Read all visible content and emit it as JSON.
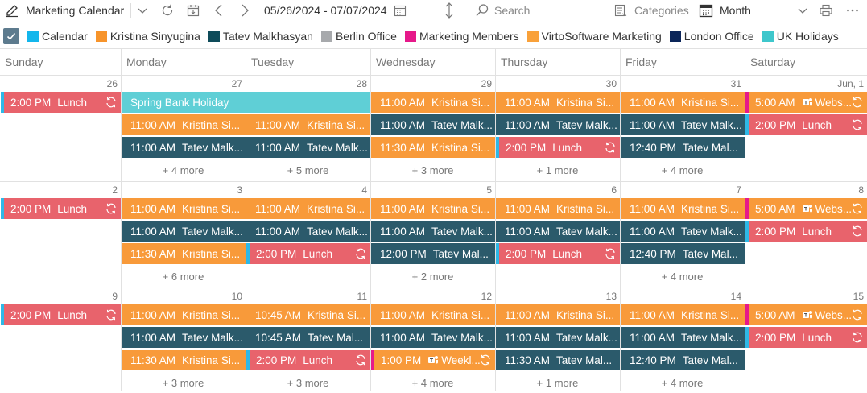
{
  "toolbar": {
    "calendar_name": "Marketing Calendar",
    "date_range": "05/26/2024 - 07/07/2024",
    "search_placeholder": "Search",
    "categories_label": "Categories",
    "view_label": "Month"
  },
  "legend": [
    {
      "label": "Calendar",
      "color": "#13b6ec"
    },
    {
      "label": "Kristina Sinyugina",
      "color": "#f7942b"
    },
    {
      "label": "Tatev Malkhasyan",
      "color": "#0e4b5a"
    },
    {
      "label": "Berlin Office",
      "color": "#a7a9ac"
    },
    {
      "label": "Marketing Members",
      "color": "#e6198a"
    },
    {
      "label": "VirtoSoftware Marketing",
      "color": "#f9a13a"
    },
    {
      "label": "London Office",
      "color": "#0b2559"
    },
    {
      "label": "UK Holidays",
      "color": "#3ec7cc"
    }
  ],
  "colors": {
    "orange": "#f89a3a",
    "teal": "#2b5a6b",
    "red": "#e8636c",
    "cyan": "#5fcfd6",
    "lunch_bar": "#2eb8e6",
    "webinar_bar": "#e6198a"
  },
  "days_of_week": [
    "Sunday",
    "Monday",
    "Tuesday",
    "Wednesday",
    "Thursday",
    "Friday",
    "Saturday"
  ],
  "weeks": [
    {
      "days": [
        "26",
        "27",
        "28",
        "29",
        "30",
        "31",
        "Jun, 1"
      ],
      "more": [
        "",
        "+ 4 more",
        "+ 5 more",
        "+ 3 more",
        "+ 1 more",
        "+ 4 more",
        ""
      ],
      "events": [
        {
          "day": 0,
          "row": 0,
          "time": "2:00 PM",
          "title": "Lunch",
          "kind": "lunch",
          "recurring": true
        },
        {
          "day": 1,
          "span": 2,
          "row": 0,
          "time": "",
          "title": "Spring Bank Holiday",
          "kind": "holiday"
        },
        {
          "day": 1,
          "row": 1,
          "time": "11:00 AM",
          "title": "Kristina Si...",
          "kind": "orange"
        },
        {
          "day": 1,
          "row": 2,
          "time": "11:00 AM",
          "title": "Tatev Malk...",
          "kind": "teal"
        },
        {
          "day": 2,
          "row": 1,
          "time": "11:00 AM",
          "title": "Kristina Si...",
          "kind": "orange"
        },
        {
          "day": 2,
          "row": 2,
          "time": "11:00 AM",
          "title": "Tatev Malk...",
          "kind": "teal"
        },
        {
          "day": 3,
          "row": 0,
          "time": "11:00 AM",
          "title": "Kristina Si...",
          "kind": "orange"
        },
        {
          "day": 3,
          "row": 1,
          "time": "11:00 AM",
          "title": "Tatev Malk...",
          "kind": "teal"
        },
        {
          "day": 3,
          "row": 2,
          "time": "11:30 AM",
          "title": "Kristina Si...",
          "kind": "orange"
        },
        {
          "day": 4,
          "row": 0,
          "time": "11:00 AM",
          "title": "Kristina Si...",
          "kind": "orange"
        },
        {
          "day": 4,
          "row": 1,
          "time": "11:00 AM",
          "title": "Tatev Malk...",
          "kind": "teal"
        },
        {
          "day": 4,
          "row": 2,
          "time": "2:00 PM",
          "title": "Lunch",
          "kind": "lunch",
          "recurring": true
        },
        {
          "day": 5,
          "row": 0,
          "time": "11:00 AM",
          "title": "Kristina Si...",
          "kind": "orange"
        },
        {
          "day": 5,
          "row": 1,
          "time": "11:00 AM",
          "title": "Tatev Malk...",
          "kind": "teal"
        },
        {
          "day": 5,
          "row": 2,
          "time": "12:40 PM",
          "title": "Tatev Mal...",
          "kind": "teal"
        },
        {
          "day": 6,
          "row": 0,
          "time": "5:00 AM",
          "title": "Webs...",
          "kind": "webinar",
          "recurring": true,
          "teams": true
        },
        {
          "day": 6,
          "row": 1,
          "time": "2:00 PM",
          "title": "Lunch",
          "kind": "lunch",
          "recurring": true
        }
      ]
    },
    {
      "days": [
        "2",
        "3",
        "4",
        "5",
        "6",
        "7",
        "8"
      ],
      "more": [
        "",
        "+ 6 more",
        "",
        "+ 2 more",
        "",
        "+ 4 more",
        ""
      ],
      "events": [
        {
          "day": 0,
          "row": 0,
          "time": "2:00 PM",
          "title": "Lunch",
          "kind": "lunch",
          "recurring": true
        },
        {
          "day": 1,
          "row": 0,
          "time": "11:00 AM",
          "title": "Kristina Si...",
          "kind": "orange"
        },
        {
          "day": 1,
          "row": 1,
          "time": "11:00 AM",
          "title": "Tatev Malk...",
          "kind": "teal"
        },
        {
          "day": 1,
          "row": 2,
          "time": "11:30 AM",
          "title": "Kristina Si...",
          "kind": "orange"
        },
        {
          "day": 2,
          "row": 0,
          "time": "11:00 AM",
          "title": "Kristina Si...",
          "kind": "orange"
        },
        {
          "day": 2,
          "row": 1,
          "time": "11:00 AM",
          "title": "Tatev Malk...",
          "kind": "teal"
        },
        {
          "day": 2,
          "row": 2,
          "time": "2:00 PM",
          "title": "Lunch",
          "kind": "lunch",
          "recurring": true
        },
        {
          "day": 3,
          "row": 0,
          "time": "11:00 AM",
          "title": "Kristina Si...",
          "kind": "orange"
        },
        {
          "day": 3,
          "row": 1,
          "time": "11:00 AM",
          "title": "Tatev Malk...",
          "kind": "teal"
        },
        {
          "day": 3,
          "row": 2,
          "time": "12:00 PM",
          "title": "Tatev Mal...",
          "kind": "teal"
        },
        {
          "day": 4,
          "row": 0,
          "time": "11:00 AM",
          "title": "Kristina Si...",
          "kind": "orange"
        },
        {
          "day": 4,
          "row": 1,
          "time": "11:00 AM",
          "title": "Tatev Malk...",
          "kind": "teal"
        },
        {
          "day": 4,
          "row": 2,
          "time": "2:00 PM",
          "title": "Lunch",
          "kind": "lunch",
          "recurring": true
        },
        {
          "day": 5,
          "row": 0,
          "time": "11:00 AM",
          "title": "Kristina Si...",
          "kind": "orange"
        },
        {
          "day": 5,
          "row": 1,
          "time": "11:00 AM",
          "title": "Tatev Malk...",
          "kind": "teal"
        },
        {
          "day": 5,
          "row": 2,
          "time": "12:40 PM",
          "title": "Tatev Mal...",
          "kind": "teal"
        },
        {
          "day": 6,
          "row": 0,
          "time": "5:00 AM",
          "title": "Webs...",
          "kind": "webinar",
          "recurring": true,
          "teams": true
        },
        {
          "day": 6,
          "row": 1,
          "time": "2:00 PM",
          "title": "Lunch",
          "kind": "lunch",
          "recurring": true
        }
      ]
    },
    {
      "days": [
        "9",
        "10",
        "11",
        "12",
        "13",
        "14",
        "15"
      ],
      "more": [
        "",
        "+ 3 more",
        "+ 3 more",
        "+ 4 more",
        "+ 1 more",
        "+ 4 more",
        ""
      ],
      "events": [
        {
          "day": 0,
          "row": 0,
          "time": "2:00 PM",
          "title": "Lunch",
          "kind": "lunch",
          "recurring": true
        },
        {
          "day": 1,
          "row": 0,
          "time": "11:00 AM",
          "title": "Kristina Si...",
          "kind": "orange"
        },
        {
          "day": 1,
          "row": 1,
          "time": "11:00 AM",
          "title": "Tatev Malk...",
          "kind": "teal"
        },
        {
          "day": 1,
          "row": 2,
          "time": "11:30 AM",
          "title": "Kristina Si...",
          "kind": "orange"
        },
        {
          "day": 2,
          "row": 0,
          "time": "10:45 AM",
          "title": "Kristina Si...",
          "kind": "orange"
        },
        {
          "day": 2,
          "row": 1,
          "time": "10:45 AM",
          "title": "Tatev Mal...",
          "kind": "teal"
        },
        {
          "day": 2,
          "row": 2,
          "time": "2:00 PM",
          "title": "Lunch",
          "kind": "lunch",
          "recurring": true
        },
        {
          "day": 3,
          "row": 0,
          "time": "11:00 AM",
          "title": "Kristina Si...",
          "kind": "orange"
        },
        {
          "day": 3,
          "row": 1,
          "time": "11:00 AM",
          "title": "Tatev Malk...",
          "kind": "teal"
        },
        {
          "day": 3,
          "row": 2,
          "time": "1:00 PM",
          "title": "Weekl...",
          "kind": "weekly",
          "recurring": true,
          "teams": true
        },
        {
          "day": 4,
          "row": 0,
          "time": "11:00 AM",
          "title": "Kristina Si...",
          "kind": "orange"
        },
        {
          "day": 4,
          "row": 1,
          "time": "11:00 AM",
          "title": "Tatev Malk...",
          "kind": "teal"
        },
        {
          "day": 4,
          "row": 2,
          "time": "11:30 AM",
          "title": "Tatev Mal...",
          "kind": "teal"
        },
        {
          "day": 5,
          "row": 0,
          "time": "11:00 AM",
          "title": "Kristina Si...",
          "kind": "orange"
        },
        {
          "day": 5,
          "row": 1,
          "time": "11:00 AM",
          "title": "Tatev Malk...",
          "kind": "teal"
        },
        {
          "day": 5,
          "row": 2,
          "time": "12:40 PM",
          "title": "Tatev Mal...",
          "kind": "teal"
        },
        {
          "day": 6,
          "row": 0,
          "time": "5:00 AM",
          "title": "Webs...",
          "kind": "webinar",
          "recurring": true,
          "teams": true
        },
        {
          "day": 6,
          "row": 1,
          "time": "2:00 PM",
          "title": "Lunch",
          "kind": "lunch",
          "recurring": true
        }
      ]
    }
  ]
}
